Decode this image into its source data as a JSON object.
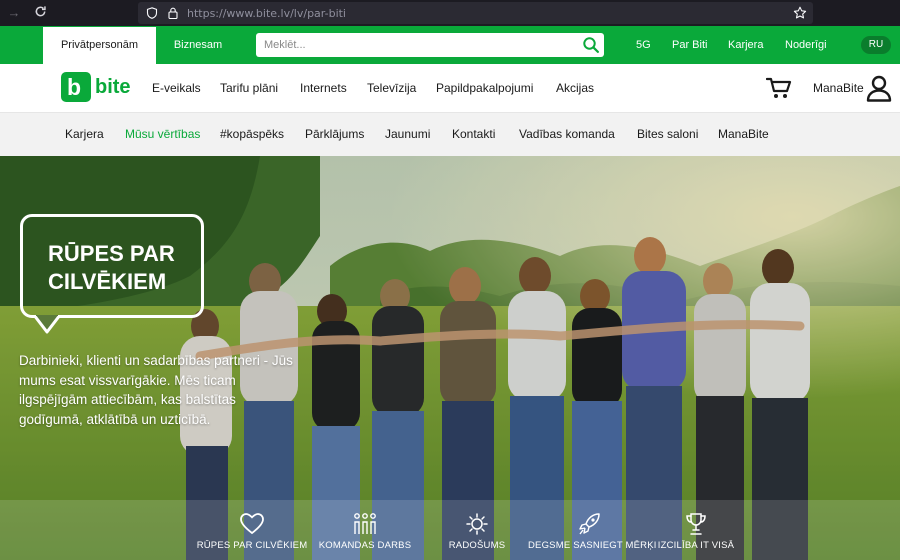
{
  "browser": {
    "url_host": "https://www.bite.lv",
    "url_path": "/lv/par-biti"
  },
  "topbar": {
    "segments": [
      "Privātpersonām",
      "Biznesam"
    ],
    "search_placeholder": "Meklēt...",
    "links": [
      "5G",
      "Par Biti",
      "Karjera",
      "Noderīgi"
    ],
    "language": "RU",
    "brand_color": "#0aa93a"
  },
  "mainnav": {
    "logo_letter": "b",
    "logo_text": "bite",
    "links": [
      "E-veikals",
      "Tarifu plāni",
      "Internets",
      "Televīzija",
      "Papildpakalpojumi",
      "Akcijas"
    ],
    "account_label": "ManaBite",
    "icons": [
      "cart-icon",
      "user-icon"
    ]
  },
  "subnav": {
    "links": [
      "Karjera",
      "Mūsu vērtības",
      "#kopāspēks",
      "Pārklājums",
      "Jaunumi",
      "Kontakti",
      "Vadības komanda",
      "Bites saloni",
      "ManaBite"
    ],
    "active": "Mūsu vērtības"
  },
  "hero": {
    "title_line1": "RŪPES PAR",
    "title_line2": "CILVĒKIEM",
    "text": "Darbinieki, klienti un sadarbības partneri - Jūs mums esat vissvarīgākie. Mēs ticam ilgspējīgām attiecībām, kas balstītas godīgumā, atklātībā un uzticībā."
  },
  "values": [
    {
      "label": "RŪPES PAR CILVĒKIEM",
      "icon": "heart-icon"
    },
    {
      "label": "KOMANDAS DARBS",
      "icon": "team-icon"
    },
    {
      "label": "RADOŠUMS",
      "icon": "creativity-icon"
    },
    {
      "label": "DEGSME SASNIEGT MĒRĶI",
      "icon": "rocket-icon"
    },
    {
      "label": "IZCILĪBA IT VISĀ",
      "icon": "trophy-icon"
    }
  ]
}
